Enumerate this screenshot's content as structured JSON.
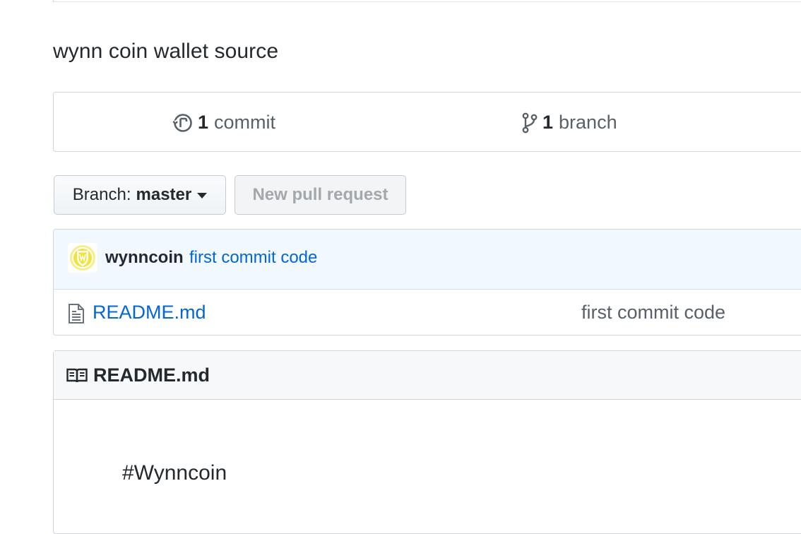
{
  "repo": {
    "description": "wynn coin wallet source"
  },
  "summary": {
    "commits_count": "1",
    "commits_label": "commit",
    "branches_count": "1",
    "branches_label": "branch"
  },
  "toolbar": {
    "branch_prefix": "Branch:",
    "branch_name": "master",
    "new_pr_label": "New pull request"
  },
  "latest_commit": {
    "author": "wynncoin",
    "message": "first commit code"
  },
  "files": [
    {
      "name": "README.md",
      "commit_message": "first commit code"
    }
  ],
  "readme": {
    "title": "README.md",
    "content": "#Wynncoin"
  },
  "colors": {
    "link": "#0366d6",
    "commit_bar_bg": "#f1f8ff",
    "border": "#d1d5da",
    "avatar_accent": "#f2e23a"
  },
  "icons": {
    "commits": "history-icon",
    "branches": "git-branch-icon",
    "file": "file-text-icon",
    "readme": "book-icon",
    "avatar": "wynncoin-avatar"
  }
}
